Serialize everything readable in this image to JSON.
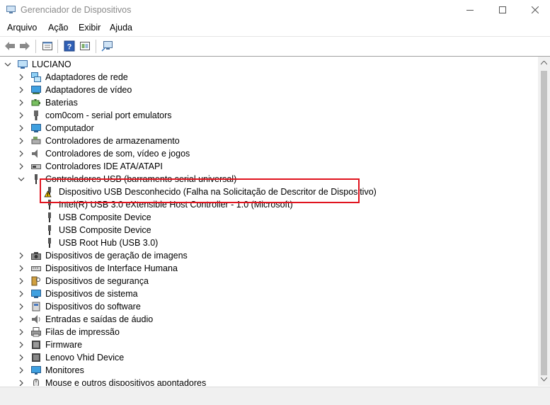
{
  "window": {
    "title": "Gerenciador de Dispositivos"
  },
  "menu": [
    {
      "label": "Arquivo"
    },
    {
      "label": "Ação"
    },
    {
      "label": "Exibir"
    },
    {
      "label": "Ajuda"
    }
  ],
  "toolbar_icons": [
    "back-arrow-icon",
    "forward-arrow-icon",
    "properties-icon",
    "help-icon",
    "update-driver-icon",
    "scan-hardware-icon"
  ],
  "tree": {
    "root": "LUCIANO",
    "categories": [
      {
        "label": "Adaptadores de rede",
        "icon": "network-adapter-icon"
      },
      {
        "label": "Adaptadores de vídeo",
        "icon": "display-adapter-icon"
      },
      {
        "label": "Baterias",
        "icon": "battery-icon"
      },
      {
        "label": "com0com - serial port emulators",
        "icon": "serial-port-icon"
      },
      {
        "label": "Computador",
        "icon": "computer-icon"
      },
      {
        "label": "Controladores de armazenamento",
        "icon": "storage-controller-icon"
      },
      {
        "label": "Controladores de som, vídeo e jogos",
        "icon": "speaker-icon"
      },
      {
        "label": "Controladores IDE ATA/ATAPI",
        "icon": "ide-controller-icon"
      }
    ],
    "usb": {
      "label": "Controladores USB (barramento serial universal)",
      "children": [
        {
          "label": "Dispositivo USB Desconhecido (Falha na Solicitação de Descritor de Dispositivo)",
          "icon": "warning-icon"
        },
        {
          "label": "Intel(R) USB 3.0 eXtensible Host Controller - 1.0 (Microsoft)",
          "icon": "usb-icon"
        },
        {
          "label": "USB Composite Device",
          "icon": "usb-icon"
        },
        {
          "label": "USB Composite Device",
          "icon": "usb-icon"
        },
        {
          "label": "USB Root Hub (USB 3.0)",
          "icon": "usb-icon"
        }
      ]
    },
    "categories_after": [
      {
        "label": "Dispositivos de geração de imagens",
        "icon": "camera-icon"
      },
      {
        "label": "Dispositivos de Interface Humana",
        "icon": "hid-icon"
      },
      {
        "label": "Dispositivos de segurança",
        "icon": "security-key-icon"
      },
      {
        "label": "Dispositivos de sistema",
        "icon": "system-devices-icon"
      },
      {
        "label": "Dispositivos do software",
        "icon": "software-device-icon"
      },
      {
        "label": "Entradas e saídas de áudio",
        "icon": "audio-io-icon"
      },
      {
        "label": "Filas de impressão",
        "icon": "printer-icon"
      },
      {
        "label": "Firmware",
        "icon": "firmware-icon"
      },
      {
        "label": "Lenovo Vhid Device",
        "icon": "lenovo-device-icon"
      },
      {
        "label": "Monitores",
        "icon": "monitor-icon"
      },
      {
        "label": "Mouse e outros dispositivos apontadores",
        "icon": "mouse-icon"
      }
    ]
  },
  "colors": {
    "highlight": "#e0141e",
    "warning": "#f2c200"
  }
}
